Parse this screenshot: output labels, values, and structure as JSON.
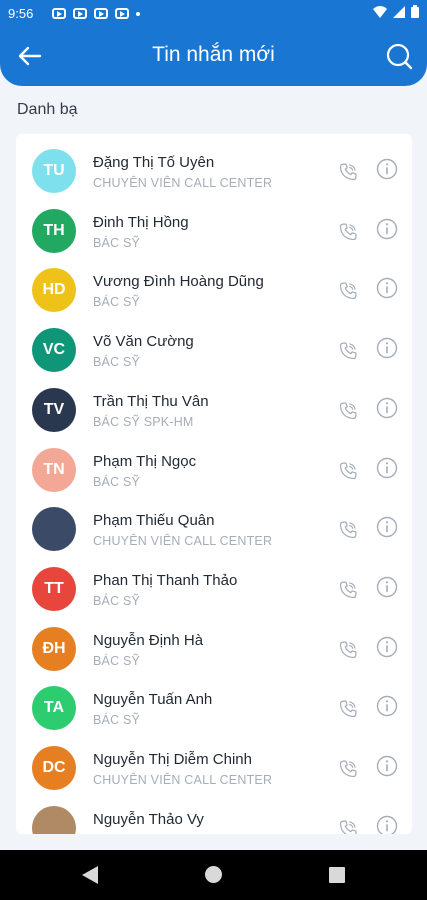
{
  "status_bar": {
    "time": "9:56"
  },
  "header": {
    "title": "Tin nhắn mới",
    "back_icon": "arrow-left-icon",
    "search_icon": "search-icon"
  },
  "section_label": "Danh bạ",
  "colors": {
    "header_bg": "#1976d2",
    "icon_gray": "#a5adb8"
  },
  "contacts": [
    {
      "initials": "TU",
      "name": "Đặng Thị Tố Uyên",
      "role": "CHUYÊN VIÊN CALL CENTER",
      "color": "#7ee0ec"
    },
    {
      "initials": "TH",
      "name": "Đinh Thị Hồng",
      "role": "BÁC SỸ",
      "color": "#21a861"
    },
    {
      "initials": "HD",
      "name": "Vương Đình Hoàng Dũng",
      "role": "BÁC SỸ",
      "color": "#efc21a"
    },
    {
      "initials": "VC",
      "name": "Võ Văn Cường",
      "role": "BÁC SỸ",
      "color": "#0f9679"
    },
    {
      "initials": "TV",
      "name": "Trần Thị Thu Vân",
      "role": "BÁC SỸ SPK-HM",
      "color": "#29384f"
    },
    {
      "initials": "TN",
      "name": "Phạm Thị Ngọc",
      "role": "BÁC SỸ",
      "color": "#f3a795"
    },
    {
      "initials": "",
      "name": "Phạm Thiếu Quân",
      "role": "CHUYÊN VIÊN CALL CENTER",
      "color": "#3b4a66"
    },
    {
      "initials": "TT",
      "name": "Phan Thị Thanh Thảo",
      "role": "BÁC SỸ",
      "color": "#e8453c"
    },
    {
      "initials": "ĐH",
      "name": "Nguyễn Định Hà",
      "role": "BÁC SỸ",
      "color": "#e67e22"
    },
    {
      "initials": "TA",
      "name": "Nguyễn Tuấn Anh",
      "role": "BÁC SỸ",
      "color": "#2ecc71"
    },
    {
      "initials": "DC",
      "name": "Nguyễn Thị Diễm Chinh",
      "role": "CHUYÊN VIÊN CALL CENTER",
      "color": "#e67e22"
    },
    {
      "initials": "",
      "name": "Nguyễn Thảo Vy",
      "role": "",
      "color": "#b08a64"
    }
  ]
}
